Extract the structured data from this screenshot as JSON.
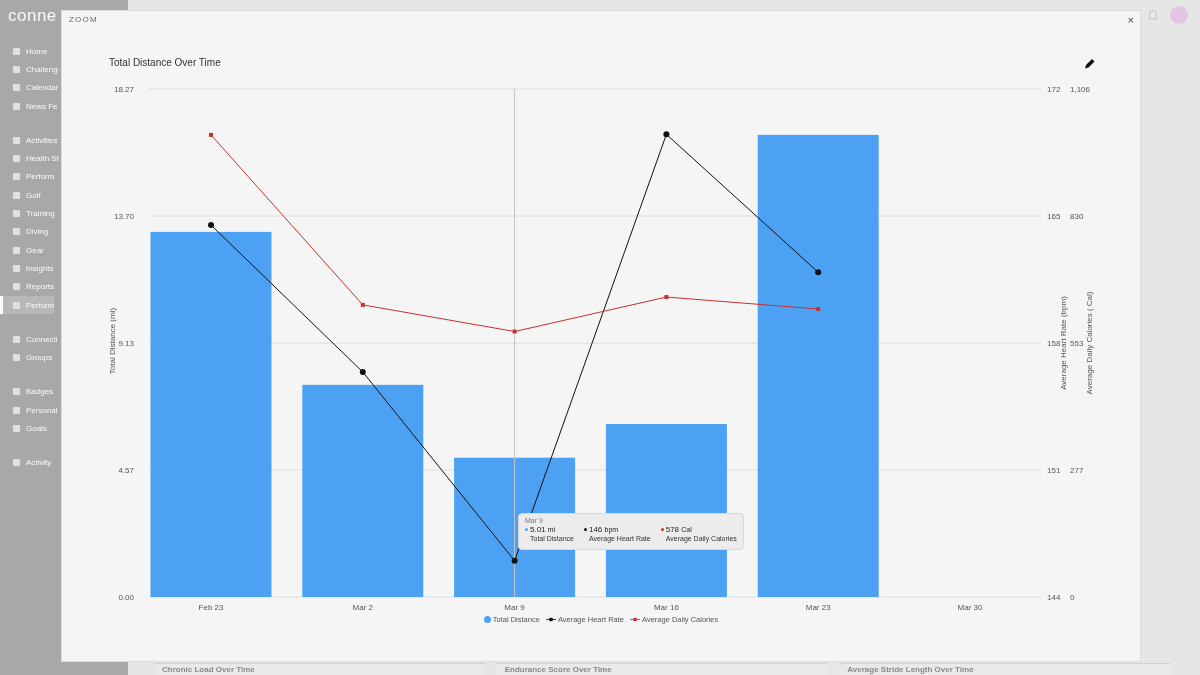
{
  "logo": {
    "text": "conne"
  },
  "sidebar": {
    "groups": [
      {
        "items": [
          {
            "label": "Home",
            "selected": false
          },
          {
            "label": "Challeng",
            "selected": false
          },
          {
            "label": "Calendar",
            "selected": false
          },
          {
            "label": "News Fe",
            "selected": false
          }
        ]
      },
      {
        "items": [
          {
            "label": "Activities",
            "selected": false
          },
          {
            "label": "Health St",
            "selected": false
          },
          {
            "label": "Perform",
            "selected": false
          },
          {
            "label": "Golf",
            "selected": false
          },
          {
            "label": "Training",
            "selected": false
          },
          {
            "label": "Diving",
            "selected": false
          },
          {
            "label": "Gear",
            "selected": false
          },
          {
            "label": "Insights",
            "selected": false
          },
          {
            "label": "Reports",
            "selected": false
          },
          {
            "label": "Perform",
            "selected": true
          }
        ]
      },
      {
        "items": [
          {
            "label": "Connecti",
            "selected": false
          },
          {
            "label": "Groups",
            "selected": false
          }
        ]
      },
      {
        "items": [
          {
            "label": "Badges",
            "selected": false
          },
          {
            "label": "Personal",
            "selected": false
          },
          {
            "label": "Goals",
            "selected": false
          }
        ]
      },
      {
        "items": [
          {
            "label": "Activity",
            "selected": false
          }
        ]
      }
    ]
  },
  "background_cards": [
    "Chronic Load Over Time",
    "Endurance Score Over Time",
    "Average Stride Length Over Time"
  ],
  "modal": {
    "title": "ZOOM",
    "close": "×",
    "chart": {
      "title": "Total Distance Over Time",
      "chart_data": {
        "type": "bar",
        "ylabel": "Total Distance (mi)",
        "y2label": "Average Heart Rate (bpm)",
        "y3label": "Average Daily Calories ( Cal)",
        "categories": [
          "Feb 23",
          "Mar 2",
          "Mar 9",
          "Mar 16",
          "Mar 23",
          "Mar 30"
        ],
        "grid": true,
        "ref_lines": [
          {
            "axis": "x",
            "value": "Mar 9"
          }
        ],
        "ylim": [
          0,
          18.27
        ],
        "y2lim": [
          144,
          172
        ],
        "y3lim": [
          0,
          1106
        ],
        "yticks": [
          {
            "value": 0,
            "label": "0.00"
          },
          {
            "value": 4.57,
            "label": "4.57"
          },
          {
            "value": 9.13,
            "label": "9.13"
          },
          {
            "value": 13.7,
            "label": "13.70"
          },
          {
            "value": 18.27,
            "label": "18.27"
          }
        ],
        "y2ticks": [
          144,
          151,
          158,
          165,
          172
        ],
        "y3ticks": [
          0,
          277,
          553,
          830,
          {
            "value": 1106,
            "label": "1,106"
          }
        ],
        "series": [
          {
            "name": "Total Distance",
            "type": "bar",
            "color": "#4da1f2",
            "values": [
              13.13,
              7.63,
              5.01,
              6.22,
              16.62,
              null
            ]
          },
          {
            "name": "Average Heart Rate",
            "type": "line",
            "marker": "circle",
            "axis": "y2",
            "color": "#111111",
            "values": [
              164.5,
              156.4,
              146,
              169.5,
              161.9,
              null
            ]
          },
          {
            "name": "Average Daily Calories",
            "type": "line",
            "marker": "square",
            "axis": "y3",
            "color": "#c8312e",
            "values": [
              1006,
              636,
              578,
              653,
              627,
              null
            ]
          }
        ]
      },
      "tooltip": {
        "date": "Mar 9",
        "entries": [
          {
            "value": "5.01",
            "unit": "mi",
            "label": "Total Distance"
          },
          {
            "value": "146",
            "unit": "bpm",
            "label": "Average Heart Rate"
          },
          {
            "value": "578",
            "unit": "Cal",
            "label": "Average Daily Calories"
          }
        ]
      }
    }
  }
}
